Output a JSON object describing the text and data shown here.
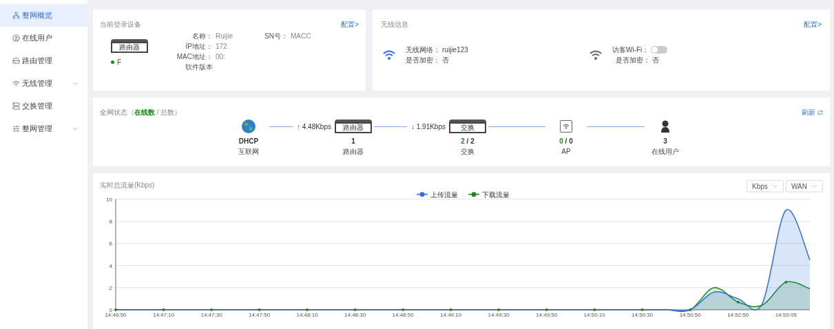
{
  "sidebar": {
    "items": [
      {
        "label": "整网概览",
        "selected": true
      },
      {
        "label": "在线用户",
        "selected": false
      },
      {
        "label": "路由管理",
        "selected": false
      },
      {
        "label": "无线管理",
        "selected": false,
        "expandable": true
      },
      {
        "label": "交换管理",
        "selected": false
      },
      {
        "label": "整网管理",
        "selected": false,
        "expandable": true
      }
    ]
  },
  "device_card": {
    "title": "当前登录设备",
    "link": "配置>",
    "device_badge": "路由器",
    "device_name": "F",
    "fields": [
      {
        "label": "名称：",
        "value": "Ruijie"
      },
      {
        "label": "SN号：",
        "value": "MACC"
      },
      {
        "label": "IP地址：",
        "value": "172"
      },
      {
        "label": "MAC地址：",
        "value": "00:"
      },
      {
        "label": "软件版本"
      }
    ]
  },
  "wireless_card": {
    "title": "无线信息",
    "link": "配置>",
    "networks": [
      {
        "kind": "main",
        "name_label": "无线网络：",
        "name_value": "ruijie123",
        "enc_label": "是否加密：",
        "enc_value": "否"
      },
      {
        "kind": "guest",
        "name_label": "访客Wi-Fi：",
        "on": false,
        "enc_label": "是否加密：",
        "enc_value": "否"
      }
    ]
  },
  "status_card": {
    "title": "全网状态（",
    "title_online": "在线数",
    "title_rest": " / 总数）",
    "refresh": "刷新",
    "nodes": [
      {
        "kind": "globe",
        "count": "DHCP",
        "label": "互联网",
        "link_rate": "↑ 4.48Kbps"
      },
      {
        "kind": "router",
        "badge": "路由器",
        "count": "1",
        "label": "路由器",
        "link_rate": "↓ 1.91Kbps"
      },
      {
        "kind": "switch",
        "badge": "交换",
        "online": "2",
        "total": " / 2",
        "label": "交换"
      },
      {
        "kind": "ap",
        "online": "0",
        "total": " / 0",
        "label": "AP"
      },
      {
        "kind": "user",
        "count": "3",
        "label": "在线用户"
      }
    ]
  },
  "traffic_card": {
    "title": "实时总流量(Kbps)",
    "selects": [
      "Kbps",
      "WAN"
    ],
    "chart_data": {
      "type": "area",
      "categories": [
        "14:46:50",
        null,
        "14:47:10",
        null,
        "14:47:30",
        null,
        "14:47:50",
        null,
        "14:48:10",
        null,
        "14:48:30",
        null,
        "14:48:50",
        null,
        "14:49:10",
        null,
        "14:49:30",
        null,
        "14:49:50",
        null,
        "14:50:10",
        null,
        "14:50:30",
        null,
        "14:50:50",
        null,
        "14:52:50",
        null,
        "14:59:05",
        null
      ],
      "ylim": [
        0,
        10
      ],
      "yticks": [
        0,
        2,
        4,
        6,
        8,
        10
      ],
      "grid": true,
      "legend": "top",
      "series": [
        {
          "name": "上传流量",
          "color": "#2f6fe0",
          "values": [
            0,
            0,
            0,
            0,
            0,
            0,
            0,
            0,
            0,
            0,
            0,
            0,
            0,
            0,
            0,
            0,
            0,
            0,
            0,
            0,
            0,
            0,
            0,
            0,
            0,
            1.6,
            1.0,
            0.5,
            9.0,
            4.5
          ]
        },
        {
          "name": "下载流量",
          "color": "#1a8a1a",
          "values": [
            0,
            0,
            0,
            0,
            0,
            0,
            0,
            0,
            0,
            0,
            0,
            0,
            0,
            0,
            0,
            0,
            0,
            0,
            0,
            0,
            0,
            0,
            0,
            0,
            0,
            2.0,
            0.7,
            0.4,
            2.5,
            1.9
          ]
        }
      ]
    }
  }
}
